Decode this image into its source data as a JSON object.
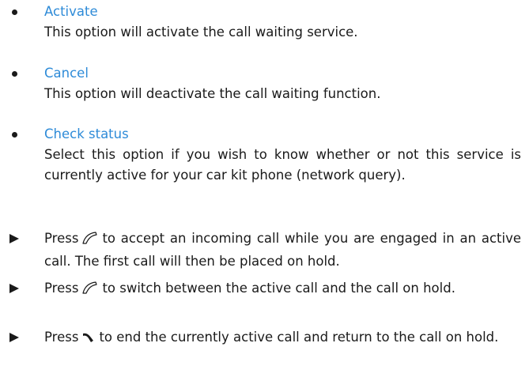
{
  "options": [
    {
      "title": "Activate",
      "description": "This option will activate the call waiting service."
    },
    {
      "title": "Cancel",
      "description": "This option will deactivate the call waiting function."
    },
    {
      "title": "Check status",
      "description": "Select this option if you wish to know whether or not this service is currently active for your car kit phone (network query)."
    }
  ],
  "steps": [
    {
      "before": "Press",
      "icon": "call-icon",
      "after": "to accept an incoming call while you are engaged in an active call. The first call will then be placed on hold."
    },
    {
      "before": "Press",
      "icon": "call-icon",
      "after": "to switch between the active call and the call on hold."
    },
    {
      "before": "Press",
      "icon": "end-call-icon",
      "after": "to end the currently active call and return to the call on hold."
    }
  ],
  "colors": {
    "title": "#2e8bd8",
    "text": "#1a1a1a"
  }
}
